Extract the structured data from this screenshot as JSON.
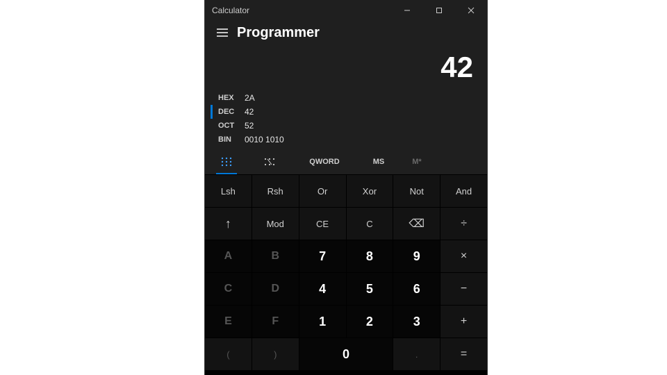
{
  "window": {
    "title": "Calculator"
  },
  "header": {
    "mode": "Programmer"
  },
  "display": {
    "value": "42"
  },
  "bases": {
    "hex": {
      "label": "HEX",
      "value": "2A"
    },
    "dec": {
      "label": "DEC",
      "value": "42",
      "active": true
    },
    "oct": {
      "label": "OCT",
      "value": "52"
    },
    "bin": {
      "label": "BIN",
      "value": "0010 1010"
    }
  },
  "toolbar": {
    "keypad_icon": "⠿",
    "bit_icon": "⁝⁝",
    "word_size": "QWORD",
    "ms": "MS",
    "mstar": "M*"
  },
  "keys": {
    "lsh": "Lsh",
    "rsh": "Rsh",
    "or": "Or",
    "xor": "Xor",
    "not": "Not",
    "and": "And",
    "up": "↑",
    "mod": "Mod",
    "ce": "CE",
    "c": "C",
    "bksp": "⌫",
    "div": "÷",
    "a": "A",
    "7": "7",
    "8": "8",
    "9": "9",
    "mul": "×",
    "b": "B",
    "4": "4",
    "5": "5",
    "6": "6",
    "sub": "−",
    "c_hex": "C",
    "d": "D",
    "1": "1",
    "2": "2",
    "3": "3",
    "add": "+",
    "e": "E",
    "f": "F",
    "lparen": "(",
    "0": "0",
    "rparen": ")",
    "dot": "."
  }
}
